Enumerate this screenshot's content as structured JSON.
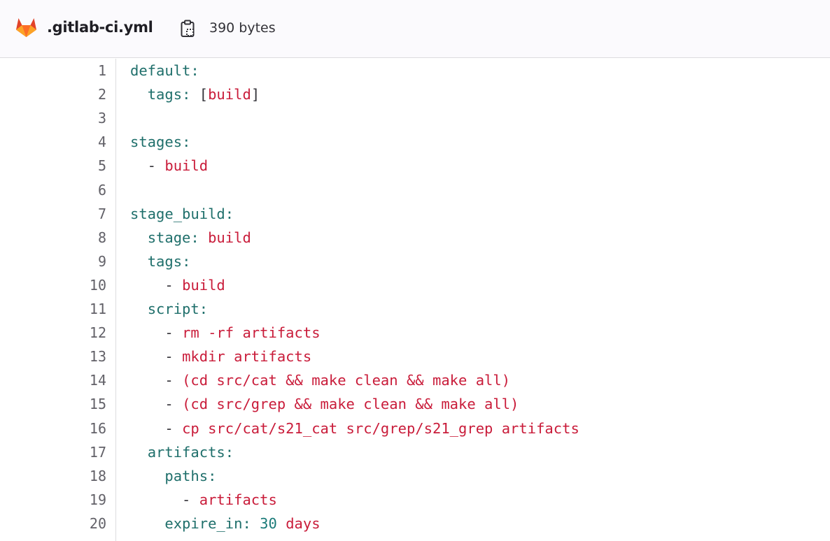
{
  "header": {
    "file_name": ".gitlab-ci.yml",
    "file_size": "390 bytes",
    "logo_icon": "gitlab-tanuki-icon",
    "copy_icon": "clipboard-copy-icon"
  },
  "colors": {
    "key": "#1f6f6b",
    "string": "#c91c3a",
    "number": "#1a7a78",
    "punct": "#333238",
    "line_number": "#626168"
  },
  "code": {
    "lines": [
      {
        "n": "1",
        "tokens": [
          {
            "t": "k",
            "v": "default"
          },
          {
            "t": "k",
            "v": ":"
          }
        ]
      },
      {
        "n": "2",
        "tokens": [
          {
            "t": "p",
            "v": "  "
          },
          {
            "t": "k",
            "v": "tags"
          },
          {
            "t": "k",
            "v": ":"
          },
          {
            "t": "p",
            "v": " ["
          },
          {
            "t": "s",
            "v": "build"
          },
          {
            "t": "p",
            "v": "]"
          }
        ]
      },
      {
        "n": "3",
        "tokens": []
      },
      {
        "n": "4",
        "tokens": [
          {
            "t": "k",
            "v": "stages"
          },
          {
            "t": "k",
            "v": ":"
          }
        ]
      },
      {
        "n": "5",
        "tokens": [
          {
            "t": "p",
            "v": "  - "
          },
          {
            "t": "s",
            "v": "build"
          }
        ]
      },
      {
        "n": "6",
        "tokens": []
      },
      {
        "n": "7",
        "tokens": [
          {
            "t": "k",
            "v": "stage_build"
          },
          {
            "t": "k",
            "v": ":"
          }
        ]
      },
      {
        "n": "8",
        "tokens": [
          {
            "t": "p",
            "v": "  "
          },
          {
            "t": "k",
            "v": "stage"
          },
          {
            "t": "k",
            "v": ":"
          },
          {
            "t": "p",
            "v": " "
          },
          {
            "t": "s",
            "v": "build"
          }
        ]
      },
      {
        "n": "9",
        "tokens": [
          {
            "t": "p",
            "v": "  "
          },
          {
            "t": "k",
            "v": "tags"
          },
          {
            "t": "k",
            "v": ":"
          }
        ]
      },
      {
        "n": "10",
        "tokens": [
          {
            "t": "p",
            "v": "    - "
          },
          {
            "t": "s",
            "v": "build"
          }
        ]
      },
      {
        "n": "11",
        "tokens": [
          {
            "t": "p",
            "v": "  "
          },
          {
            "t": "k",
            "v": "script"
          },
          {
            "t": "k",
            "v": ":"
          }
        ]
      },
      {
        "n": "12",
        "tokens": [
          {
            "t": "p",
            "v": "    - "
          },
          {
            "t": "s",
            "v": "rm -rf artifacts"
          }
        ]
      },
      {
        "n": "13",
        "tokens": [
          {
            "t": "p",
            "v": "    - "
          },
          {
            "t": "s",
            "v": "mkdir artifacts"
          }
        ]
      },
      {
        "n": "14",
        "tokens": [
          {
            "t": "p",
            "v": "    - "
          },
          {
            "t": "s",
            "v": "(cd src/cat && make clean && make all)"
          }
        ]
      },
      {
        "n": "15",
        "tokens": [
          {
            "t": "p",
            "v": "    - "
          },
          {
            "t": "s",
            "v": "(cd src/grep && make clean && make all)"
          }
        ]
      },
      {
        "n": "16",
        "tokens": [
          {
            "t": "p",
            "v": "    - "
          },
          {
            "t": "s",
            "v": "cp src/cat/s21_cat src/grep/s21_grep artifacts"
          }
        ]
      },
      {
        "n": "17",
        "tokens": [
          {
            "t": "p",
            "v": "  "
          },
          {
            "t": "k",
            "v": "artifacts"
          },
          {
            "t": "k",
            "v": ":"
          }
        ]
      },
      {
        "n": "18",
        "tokens": [
          {
            "t": "p",
            "v": "    "
          },
          {
            "t": "k",
            "v": "paths"
          },
          {
            "t": "k",
            "v": ":"
          }
        ]
      },
      {
        "n": "19",
        "tokens": [
          {
            "t": "p",
            "v": "      - "
          },
          {
            "t": "s",
            "v": "artifacts"
          }
        ]
      },
      {
        "n": "20",
        "tokens": [
          {
            "t": "p",
            "v": "    "
          },
          {
            "t": "k",
            "v": "expire_in"
          },
          {
            "t": "k",
            "v": ":"
          },
          {
            "t": "p",
            "v": " "
          },
          {
            "t": "n",
            "v": "30"
          },
          {
            "t": "p",
            "v": " "
          },
          {
            "t": "s",
            "v": "days"
          }
        ]
      }
    ]
  }
}
